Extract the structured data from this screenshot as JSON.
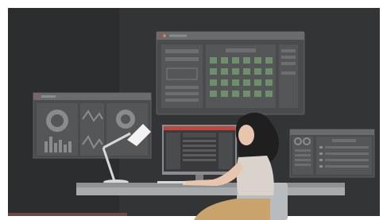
{
  "scene": {
    "description_free": true,
    "palette": {
      "background_dark": "#2c2d2f",
      "background_mid": "#3a3b3d",
      "panel_fill": "#4a4b4d",
      "panel_border": "#5f6062",
      "panel_header": "#6a6b6d",
      "accent_green": "#6d8f6a",
      "accent_red": "#b0463e",
      "desk_top": "#8f9295",
      "desk_front": "#a8abae",
      "chair": "#b9bcbf",
      "hair": "#1f1f20",
      "skin": "#e8c6ad",
      "shirt": "#d9d3cc",
      "skirt": "#c9a36b",
      "lamp": "#d8d8d8",
      "lamp_light": "#f2f2f2",
      "monitor_frame": "#8a8c8f",
      "monitor_screen": "#3a3a3c",
      "monitor_top_bar": "#c0453c"
    }
  }
}
